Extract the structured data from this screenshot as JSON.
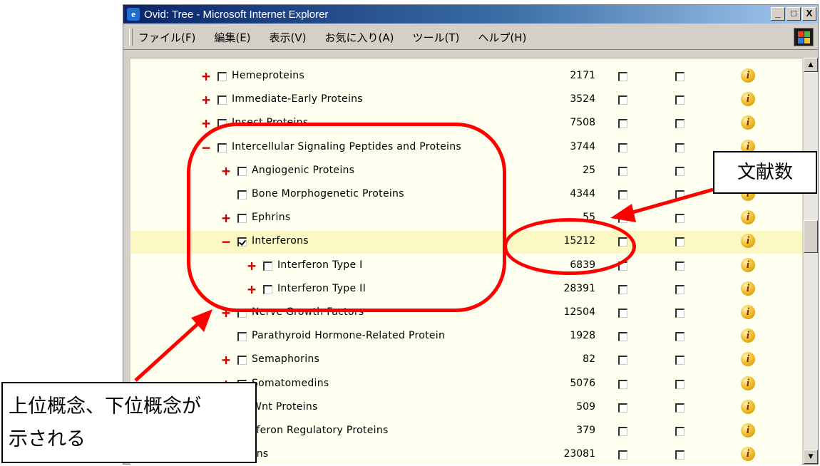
{
  "window": {
    "title": "Ovid: Tree - Microsoft Internet Explorer",
    "buttons": [
      "_",
      "□",
      "X"
    ]
  },
  "menu": [
    "ファイル(F)",
    "編集(E)",
    "表示(V)",
    "お気に入り(A)",
    "ツール(T)",
    "ヘルプ(H)"
  ],
  "colors": {
    "highlight_row": "#fbf8c4",
    "annotation_red": "#ff0000",
    "expand_sign": "#d00000"
  },
  "rows": [
    {
      "expand": "+",
      "label": "Hemeproteins",
      "count": "2171",
      "checked": false,
      "level": 1
    },
    {
      "expand": "+",
      "label": "Immediate-Early Proteins",
      "count": "3524",
      "checked": false,
      "level": 1
    },
    {
      "expand": "+",
      "label": "Insect Proteins",
      "count": "7508",
      "checked": false,
      "level": 1
    },
    {
      "expand": "−",
      "label": "Intercellular Signaling Peptides and Proteins",
      "count": "3744",
      "checked": false,
      "level": 1
    },
    {
      "expand": "+",
      "label": "Angiogenic Proteins",
      "count": "25",
      "checked": false,
      "level": 2
    },
    {
      "expand": "",
      "label": "Bone Morphogenetic Proteins",
      "count": "4344",
      "checked": false,
      "level": 2
    },
    {
      "expand": "+",
      "label": "Ephrins",
      "count": "55",
      "checked": false,
      "level": 2
    },
    {
      "expand": "−",
      "label": "Interferons",
      "count": "15212",
      "checked": true,
      "level": 2,
      "highlight": true
    },
    {
      "expand": "+",
      "label": "Interferon Type I",
      "count": "6839",
      "checked": false,
      "level": 3
    },
    {
      "expand": "+",
      "label": "Interferon Type II",
      "count": "28391",
      "checked": false,
      "level": 3
    },
    {
      "expand": "+",
      "label": "Nerve Growth Factors",
      "count": "12504",
      "checked": false,
      "level": 2
    },
    {
      "expand": "",
      "label": "Parathyroid Hormone-Related Protein",
      "count": "1928",
      "checked": false,
      "level": 2
    },
    {
      "expand": "+",
      "label": "Semaphorins",
      "count": "82",
      "checked": false,
      "level": 2
    },
    {
      "expand": "+",
      "label": "Somatomedins",
      "count": "5076",
      "checked": false,
      "level": 2
    },
    {
      "expand": "+",
      "label": "Wnt Proteins",
      "count": "509",
      "checked": false,
      "level": 2
    },
    {
      "expand": "+",
      "label": "Interferon Regulatory Proteins",
      "count": "379",
      "checked": false,
      "level": 1
    },
    {
      "expand": "+",
      "label": "Lectins",
      "count": "23081",
      "checked": false,
      "level": 1
    }
  ],
  "annotations": {
    "count_callout": "文献数",
    "hierarchy_callout_line1": "上位概念、下位概念が",
    "hierarchy_callout_line2": "示される"
  },
  "info_icon_glyph": "i"
}
